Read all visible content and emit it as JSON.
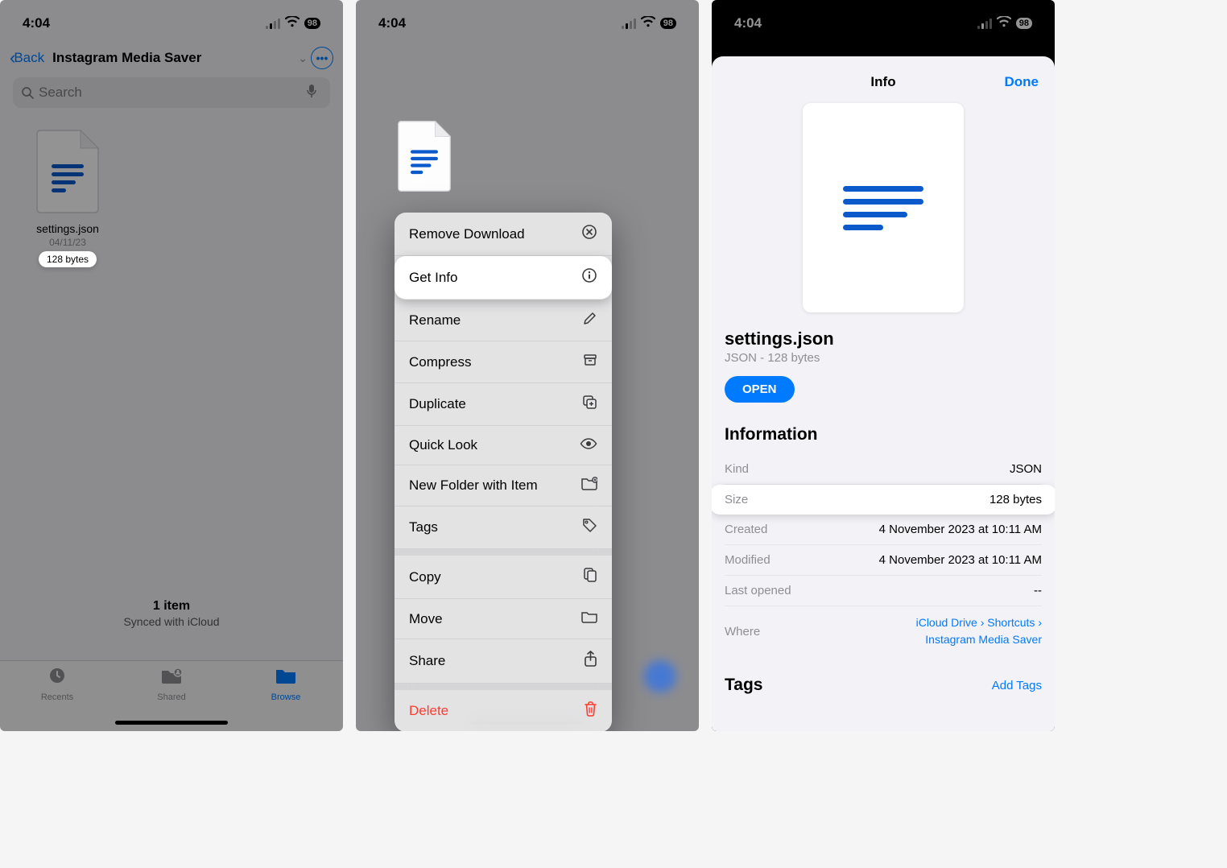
{
  "status": {
    "time": "4:04",
    "battery": "98"
  },
  "nav": {
    "back": "Back",
    "title": "Instagram Media Saver"
  },
  "search": {
    "placeholder": "Search"
  },
  "file": {
    "name": "settings.json",
    "date": "04/11/23",
    "size": "128 bytes"
  },
  "footer": {
    "count": "1 item",
    "sync": "Synced with iCloud",
    "tabs": {
      "recents": "Recents",
      "shared": "Shared",
      "browse": "Browse"
    }
  },
  "menu": {
    "remove_download": "Remove Download",
    "get_info": "Get Info",
    "rename": "Rename",
    "compress": "Compress",
    "duplicate": "Duplicate",
    "quick_look": "Quick Look",
    "new_folder": "New Folder with Item",
    "tags": "Tags",
    "copy": "Copy",
    "move": "Move",
    "share": "Share",
    "delete": "Delete"
  },
  "info": {
    "title": "Info",
    "done": "Done",
    "filename": "settings.json",
    "subtitle": "JSON - 128 bytes",
    "open": "OPEN",
    "section": "Information",
    "rows": {
      "kind_k": "Kind",
      "kind_v": "JSON",
      "size_k": "Size",
      "size_v": "128 bytes",
      "created_k": "Created",
      "created_v": "4 November 2023 at 10:11 AM",
      "modified_k": "Modified",
      "modified_v": "4 November 2023 at 10:11 AM",
      "last_k": "Last opened",
      "last_v": "--",
      "where_k": "Where",
      "where_crumbs": [
        "iCloud Drive",
        "Shortcuts",
        "Instagram Media Saver"
      ]
    },
    "tags_hdr": "Tags",
    "add_tags": "Add Tags"
  }
}
